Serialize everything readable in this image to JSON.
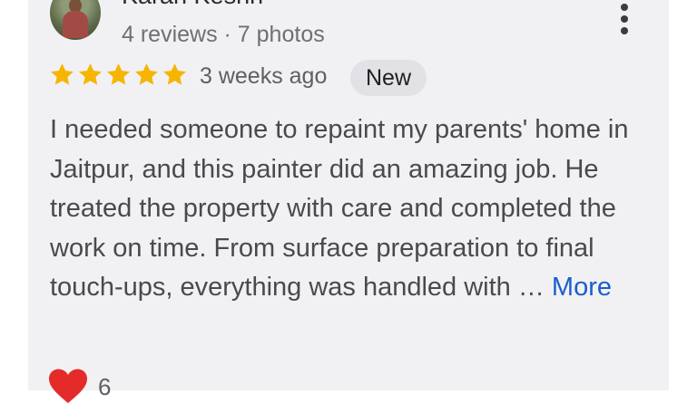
{
  "review": {
    "author_name": "Karan Keshri",
    "author_meta": "4 reviews · 7 photos",
    "rating": 5,
    "rating_max": 5,
    "date": "3 weeks ago",
    "badge": "New",
    "text": "I needed someone to repaint my parents' home in Jaitpur, and this painter did an amazing job. He treated the property with care and completed the work on time. From surface preparation to final touch-ups, everything was handled with …",
    "more_label": "More",
    "reaction_count": "6"
  },
  "colors": {
    "star": "#f6b500",
    "link": "#1a5fc9",
    "heart": "#e52a2a",
    "card_bg": "#f1f1f4"
  },
  "icons": {
    "menu": "more-vertical-icon",
    "star": "star-icon",
    "reaction": "heart-icon"
  }
}
